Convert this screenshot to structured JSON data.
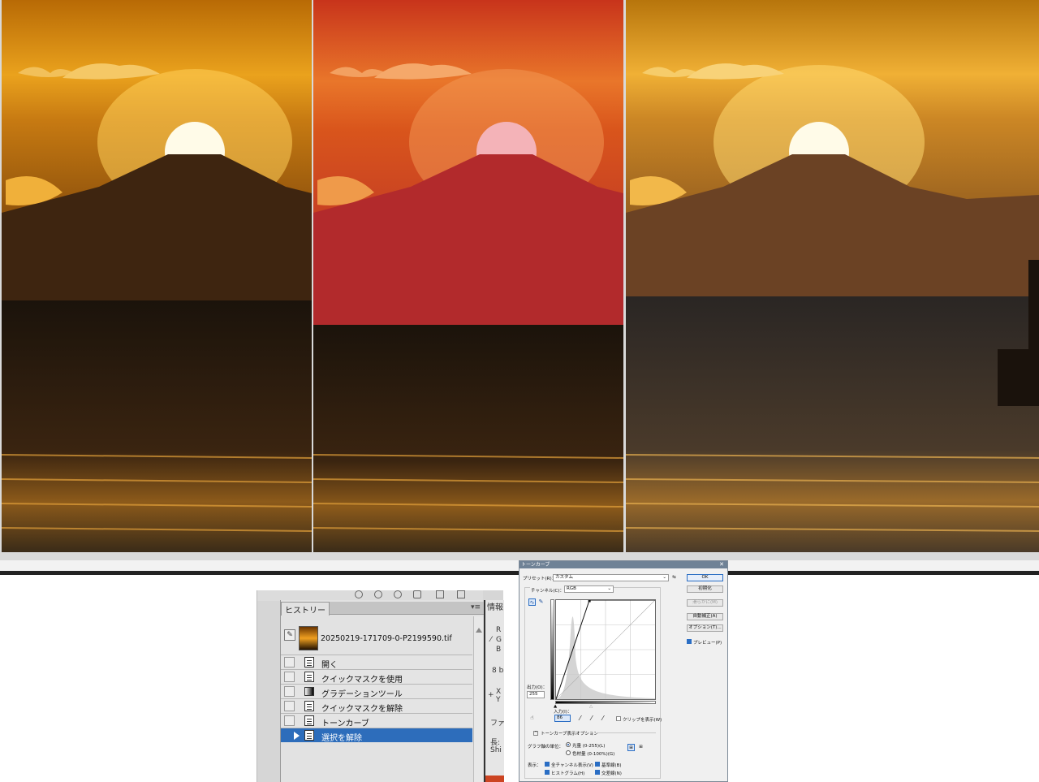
{
  "history_panel": {
    "tab_label": "ヒストリー",
    "menu_icon": "panel-menu-icon",
    "snapshot_label": "20250219-171709-0-P2199590.tif",
    "items": [
      {
        "label": "開く",
        "icon": "document-icon",
        "selected": false
      },
      {
        "label": "クイックマスクを使用",
        "icon": "document-icon",
        "selected": false
      },
      {
        "label": "グラデーションツール",
        "icon": "gradient-icon",
        "selected": false
      },
      {
        "label": "クイックマスクを解除",
        "icon": "document-icon",
        "selected": false
      },
      {
        "label": "トーンカーブ",
        "icon": "document-icon",
        "selected": false
      },
      {
        "label": "選択を解除",
        "icon": "document-icon",
        "selected": true
      }
    ]
  },
  "info_panel": {
    "tab_label": "情報",
    "lines": [
      "R",
      "G",
      "B",
      "8 b",
      "X",
      "Y",
      "ファ",
      "長:",
      "Shi"
    ]
  },
  "tone_curve_dialog": {
    "title": "トーンカーブ",
    "preset_label": "プリセット(R)：",
    "preset_value": "カスタム",
    "channel_label": "チャンネル(C)：",
    "channel_value": "RGB",
    "output_label": "出力(O)：",
    "output_value": "255",
    "input_label": "入力(I)：",
    "input_value": "86",
    "show_clipping_label": "クリップを表示(W)",
    "display_options_label": "トーンカーブ表示オプション",
    "curve_unit_label": "グラフ軸の単位：",
    "radio_light": "光量 (0-255)(L)",
    "radio_pigment": "色材量 (0-100%)(G)",
    "show_label": "表示：",
    "check_channel_overlay": "全チャンネル表示(V)",
    "check_baseline": "基準線(B)",
    "check_histogram": "ヒストグラム(H)",
    "check_intersection": "交差線(N)",
    "buttons": {
      "ok": "OK",
      "reset": "初期化",
      "smooth": "滑らかに(M)",
      "auto": "自動補正(A)",
      "options": "オプション(T)...",
      "preview": "プレビュー(P)"
    },
    "curve_points": [
      [
        0,
        0
      ],
      [
        86,
        255
      ]
    ]
  }
}
